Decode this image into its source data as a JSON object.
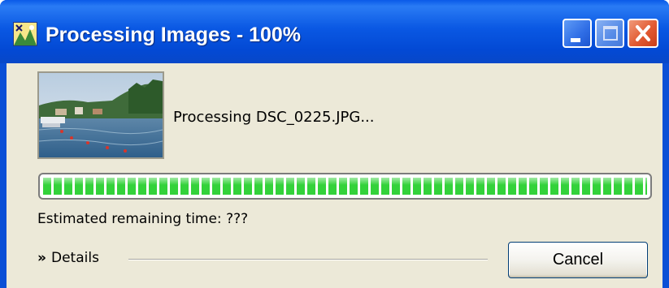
{
  "window": {
    "title": "Processing Images - 100%",
    "colors": {
      "titlebar": "#0a58e3",
      "client_bg": "#ece9d8",
      "progress_fill": "#33d23a"
    }
  },
  "titlebar_buttons": {
    "minimize_icon": "minimize-icon",
    "maximize_icon": "maximize-icon",
    "close_icon": "close-icon"
  },
  "content": {
    "processing_label": "Processing DSC_0225.JPG...",
    "progress_percent": 100,
    "remaining_label": "Estimated remaining time: ???",
    "details_label": "Details",
    "details_chevron": "»",
    "cancel_label": "Cancel"
  }
}
